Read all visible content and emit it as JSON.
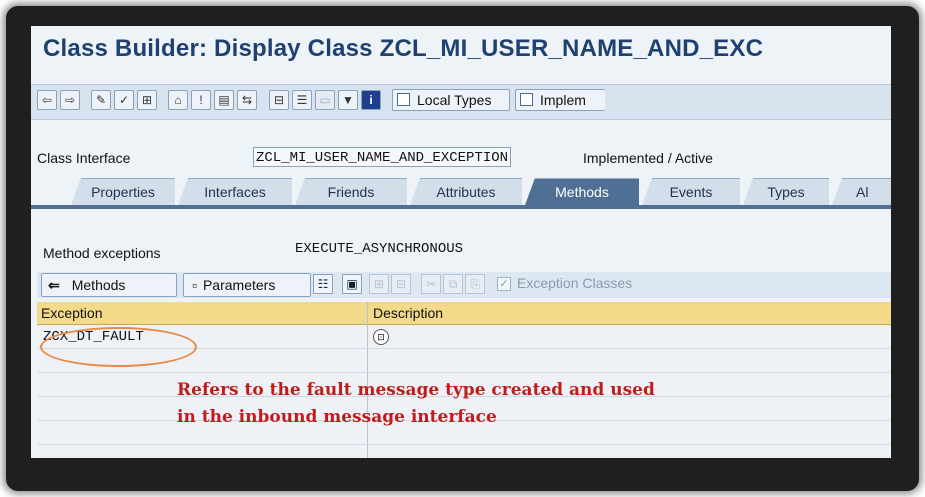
{
  "window": {
    "title": "Class Builder: Display Class ZCL_MI_USER_NAME_AND_EXC"
  },
  "toolbar": {
    "icons": [
      "back-arrow-icon",
      "forward-arrow-icon",
      "edit-pencil-icon",
      "check-icon",
      "activate-icon",
      "where-used-icon",
      "info-icon",
      "display-object-list-icon",
      "navigate-icon",
      "hierarchy-icon",
      "tree-icon",
      "blank-icon",
      "filter-icon",
      "info-i-icon"
    ],
    "local_types_label": "Local Types",
    "implem_label": "Implem"
  },
  "class_interface": {
    "label": "Class Interface",
    "value": "ZCL_MI_USER_NAME_AND_EXCEPTION",
    "status": "Implemented / Active"
  },
  "tabs": [
    {
      "label": "Properties",
      "active": false
    },
    {
      "label": "Interfaces",
      "active": false
    },
    {
      "label": "Friends",
      "active": false
    },
    {
      "label": "Attributes",
      "active": false
    },
    {
      "label": "Methods",
      "active": true
    },
    {
      "label": "Events",
      "active": false
    },
    {
      "label": "Types",
      "active": false
    },
    {
      "label": "Al",
      "active": false
    }
  ],
  "method_exceptions": {
    "label": "Method exceptions",
    "value": "EXECUTE_ASYNCHRONOUS"
  },
  "sub_toolbar": {
    "methods_label": "Methods",
    "parameters_label": "Parameters",
    "exception_classes_label": "Exception Classes",
    "exception_classes_checked": true
  },
  "grid": {
    "columns": [
      "Exception",
      "Description"
    ],
    "rows": [
      {
        "exception": "ZCX_DT_FAULT",
        "description": ""
      }
    ]
  },
  "annotation": {
    "line1": "Refers to the fault message type created and used",
    "line2": "in the inbound message interface",
    "color": "#c21b1b"
  }
}
